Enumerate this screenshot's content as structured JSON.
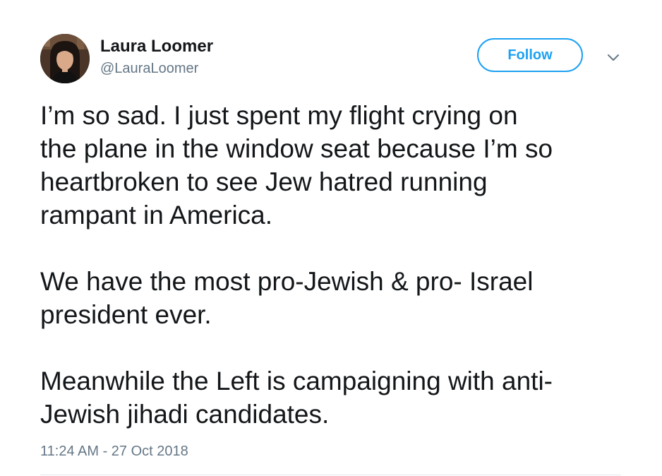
{
  "user": {
    "display_name": "Laura Loomer",
    "handle": "@LauraLoomer"
  },
  "header": {
    "follow_label": "Follow",
    "menu_icon": "chevron-down-icon"
  },
  "tweet": {
    "paragraphs": [
      "I’m so sad. I just spent my flight crying on\nthe plane in the window seat because I’m so\nheartbroken to see  Jew hatred running\nrampant in America.",
      "We have the most pro-Jewish & pro- Israel\npresident ever.",
      "Meanwhile the Left is campaigning with anti-\nJewish jihadi candidates."
    ],
    "timestamp": "11:24 AM - 27 Oct 2018"
  },
  "colors": {
    "accent": "#1da1f2",
    "text": "#14171a",
    "secondary_text": "#657786",
    "divider": "#e1e8ed"
  }
}
